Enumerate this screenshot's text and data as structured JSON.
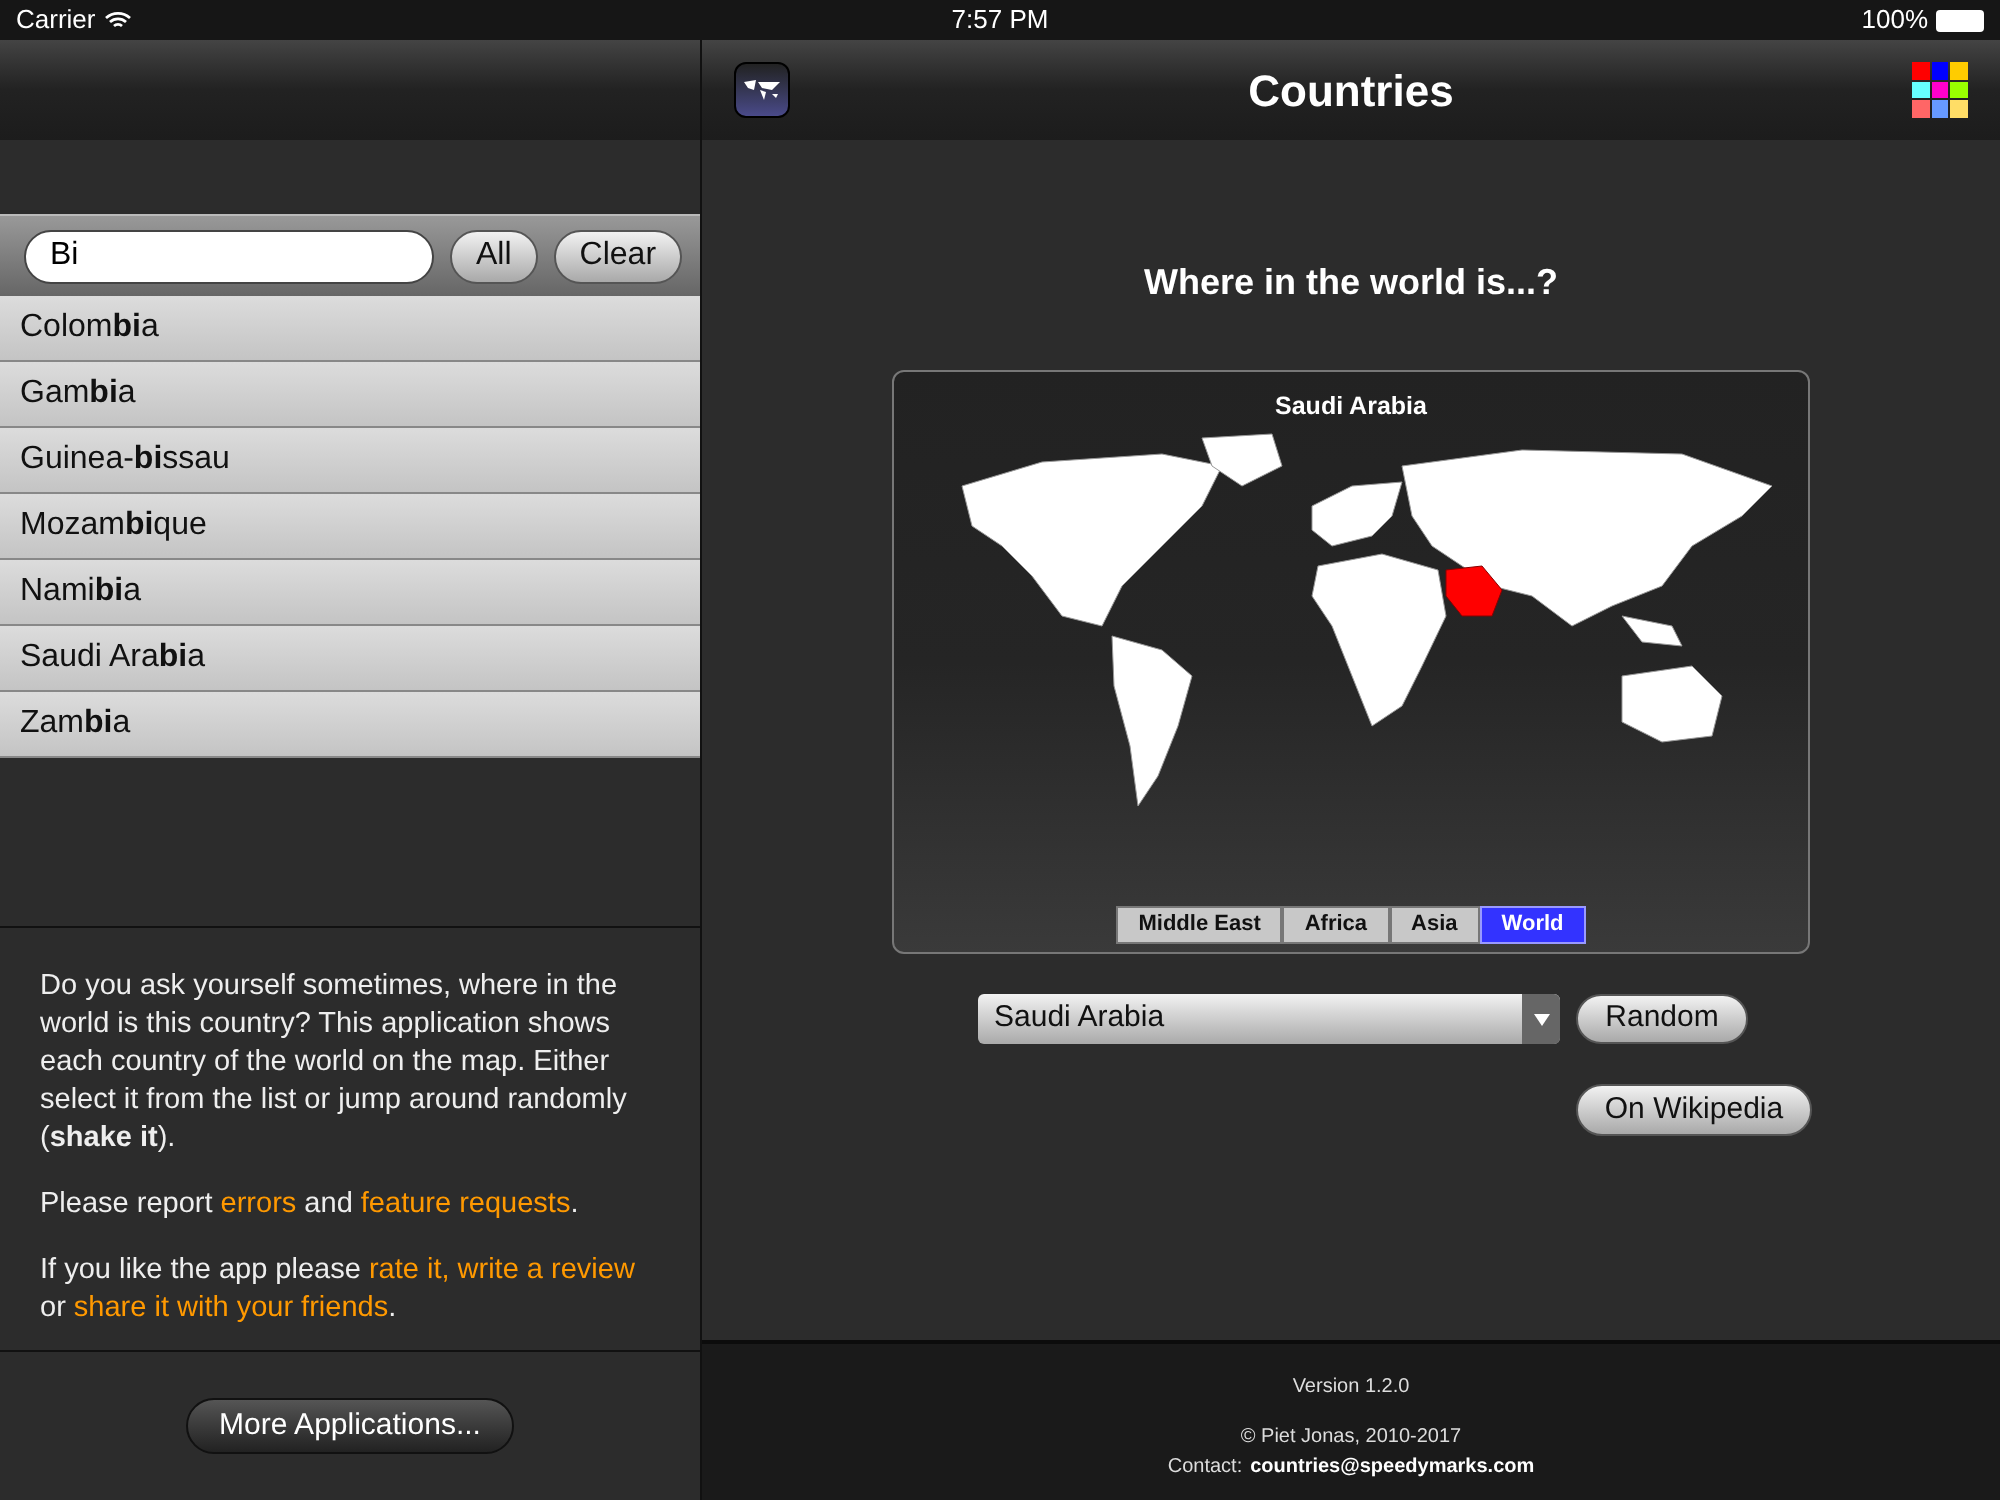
{
  "status_bar": {
    "carrier": "Carrier",
    "time": "7:57 PM",
    "battery": "100%"
  },
  "search": {
    "value": "Bi",
    "buttons": [
      "All",
      "Clear"
    ]
  },
  "results": [
    "Colom**bi**a",
    "Gam**bi**a",
    "Guinea-**bi**ssau",
    "Mozam**bi**que",
    "Nami**bi**a",
    "Saudi Ara**bi**a",
    "Zam**bi**a"
  ],
  "about": [
    [
      {
        "kind": "text",
        "text": "Do you ask yourself sometimes, where in the world is this country? This application shows each country of the world on the map. Either select it from the list or jump around randomly ("
      },
      {
        "kind": "bold",
        "text": "shake it"
      },
      {
        "kind": "text",
        "text": ")."
      }
    ],
    [
      {
        "kind": "text",
        "text": "Please report "
      },
      {
        "kind": "link",
        "text": "errors"
      },
      {
        "kind": "text",
        "text": " and "
      },
      {
        "kind": "link",
        "text": "feature requests"
      },
      {
        "kind": "text",
        "text": "."
      }
    ],
    [
      {
        "kind": "text",
        "text": "If you like the app please "
      },
      {
        "kind": "link",
        "text": "rate it, write a review"
      },
      {
        "kind": "text",
        "text": " or "
      },
      {
        "kind": "link",
        "text": "share it with your friends"
      },
      {
        "kind": "text",
        "text": "."
      }
    ]
  ],
  "more_button": "More Applications...",
  "window": {
    "title": "Countries"
  },
  "question": "Where in the world is...?",
  "map": {
    "caption": "Saudi Arabia",
    "regions": [
      {
        "label": "Middle East",
        "selected": false
      },
      {
        "label": "Africa",
        "selected": false
      },
      {
        "label": "Asia",
        "selected": false
      },
      {
        "label": "World",
        "selected": true
      }
    ]
  },
  "country_select": {
    "value": "Saudi Arabia"
  },
  "random_button": "Random",
  "wikipedia_button": "On Wikipedia",
  "footer": {
    "version": "Version 1.2.0",
    "copyright": "© Piet Jonas, 2010-2017",
    "contact_label": "Contact:",
    "contact_email": "countries@speedymarks.com"
  }
}
